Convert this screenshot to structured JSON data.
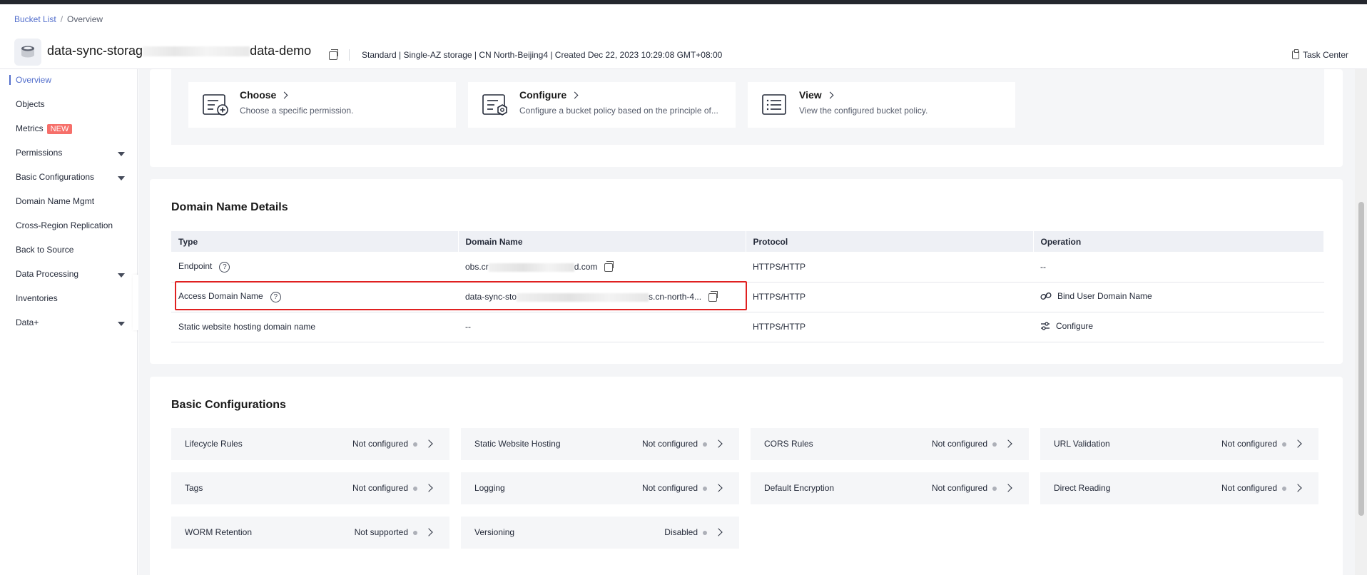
{
  "breadcrumb": {
    "parent": "Bucket List",
    "separator": "/",
    "current": "Overview"
  },
  "bucket": {
    "name_prefix": "data-sync-storag",
    "name_suffix": "data-demo",
    "meta": "Standard | Single-AZ storage | CN North-Beijing4 | Created  Dec 22, 2023 10:29:08 GMT+08:00"
  },
  "task_center": "Task Center",
  "sidebar": {
    "items": [
      {
        "label": "Overview",
        "active": true
      },
      {
        "label": "Objects"
      },
      {
        "label": "Metrics",
        "badge": "NEW"
      },
      {
        "label": "Permissions",
        "expandable": true
      },
      {
        "label": "Basic Configurations",
        "expandable": true
      },
      {
        "label": "Domain Name Mgmt"
      },
      {
        "label": "Cross-Region Replication"
      },
      {
        "label": "Back to Source"
      },
      {
        "label": "Data Processing",
        "expandable": true
      },
      {
        "label": "Inventories"
      },
      {
        "label": "Data+",
        "expandable": true
      }
    ]
  },
  "permissions": {
    "cards": [
      {
        "title": "Choose",
        "desc": "Choose a specific permission."
      },
      {
        "title": "Configure",
        "desc": "Configure a bucket policy based on the principle of..."
      },
      {
        "title": "View",
        "desc": "View the configured bucket policy."
      }
    ]
  },
  "domain": {
    "title": "Domain Name Details",
    "columns": [
      "Type",
      "Domain Name",
      "Protocol",
      "Operation"
    ],
    "rows": [
      {
        "type": "Endpoint",
        "domain_start": "obs.cr",
        "domain_end": "d.com",
        "protocol": "HTTPS/HTTP",
        "operation": "--"
      },
      {
        "type": "Access Domain Name",
        "domain_start": "data-sync-sto",
        "domain_end": "s.cn-north-4...",
        "protocol": "HTTPS/HTTP",
        "operation": "Bind User Domain Name"
      },
      {
        "type": "Static website hosting domain name",
        "domain": "--",
        "protocol": "HTTPS/HTTP",
        "operation": "Configure"
      }
    ]
  },
  "basic": {
    "title": "Basic Configurations",
    "tiles": [
      {
        "label": "Lifecycle Rules",
        "status": "Not configured"
      },
      {
        "label": "Static Website Hosting",
        "status": "Not configured"
      },
      {
        "label": "CORS Rules",
        "status": "Not configured"
      },
      {
        "label": "URL Validation",
        "status": "Not configured"
      },
      {
        "label": "Tags",
        "status": "Not configured"
      },
      {
        "label": "Logging",
        "status": "Not configured"
      },
      {
        "label": "Default Encryption",
        "status": "Not configured"
      },
      {
        "label": "Direct Reading",
        "status": "Not configured"
      },
      {
        "label": "WORM Retention",
        "status": "Not supported"
      },
      {
        "label": "Versioning",
        "status": "Disabled"
      }
    ]
  },
  "colors": {
    "accent": "#526ecc",
    "highlight": "#e02020",
    "badge": "#f66f6a"
  }
}
